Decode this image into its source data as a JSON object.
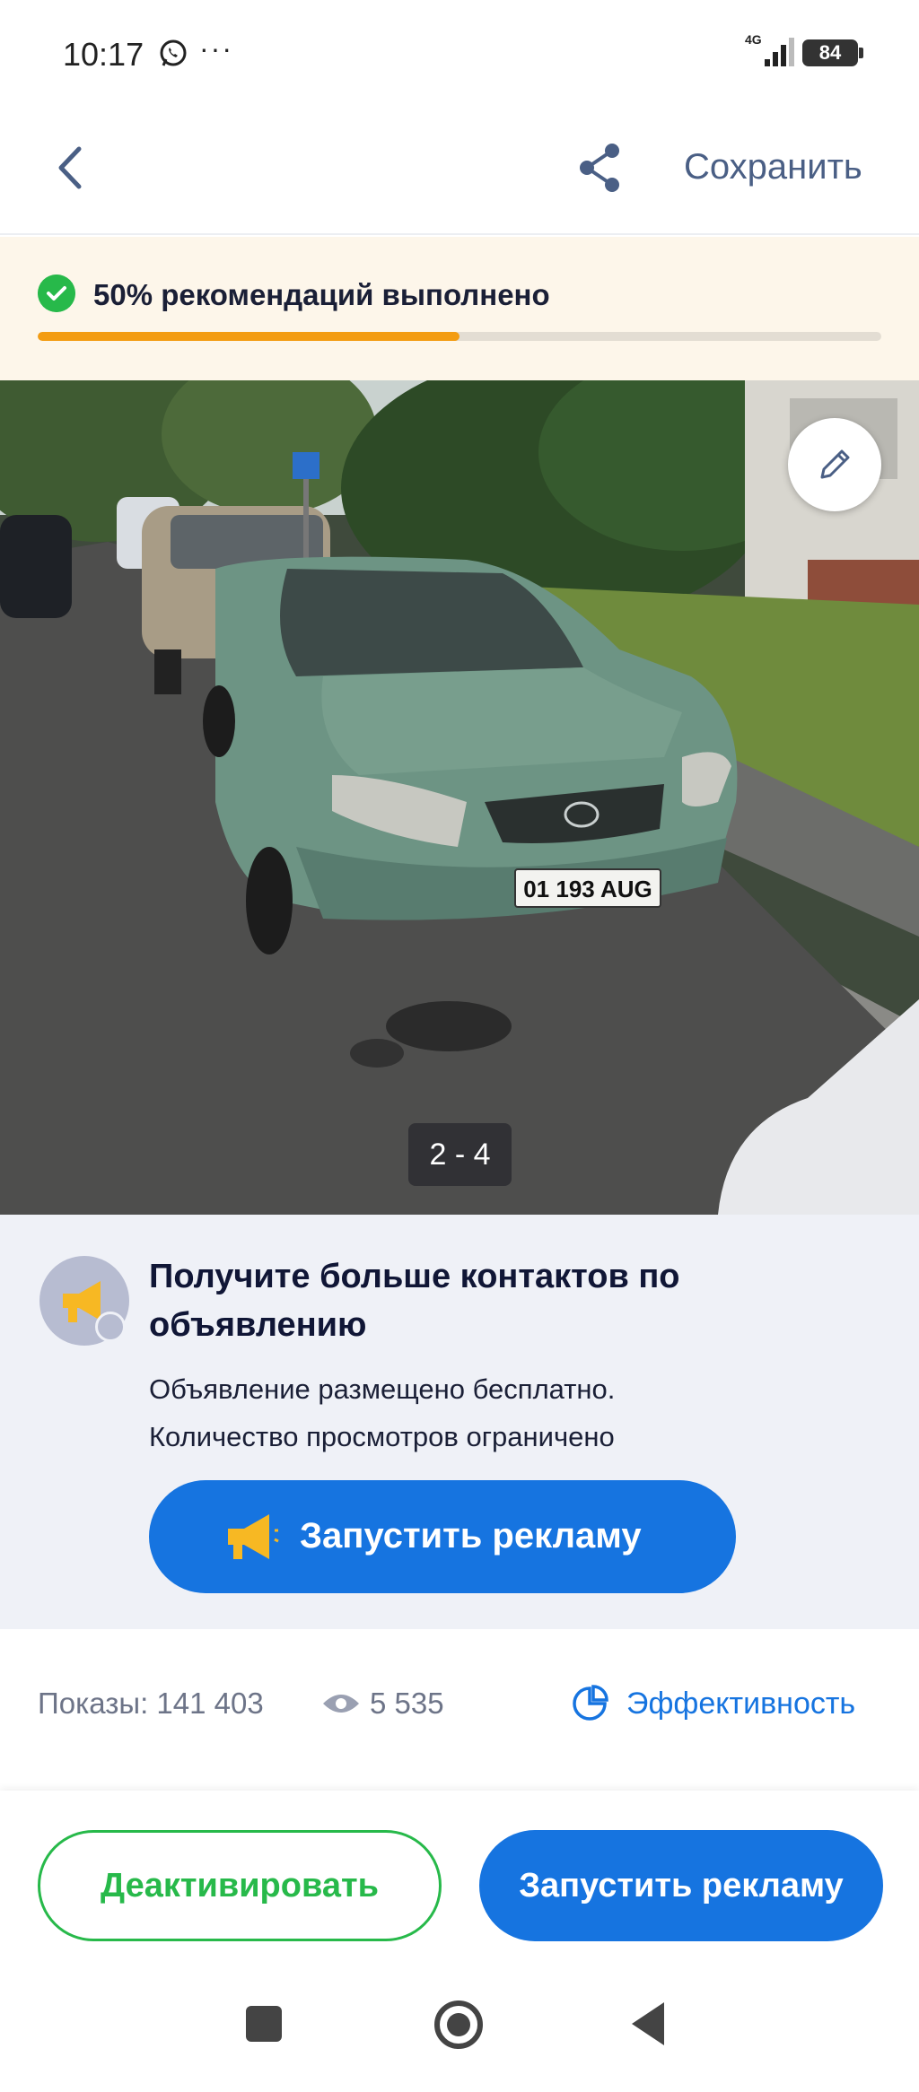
{
  "status_bar": {
    "time": "10:17",
    "dots": "···",
    "network": "4G",
    "battery": "84"
  },
  "header": {
    "save_label": "Сохранить"
  },
  "recommendations": {
    "text": "50% рекомендаций выполнено",
    "progress_percent": 50,
    "progress_color": "#f39c12"
  },
  "photo": {
    "counter": "2 - 4",
    "plate": "01 193 AUG"
  },
  "promo": {
    "title": "Получите больше контактов по объявлению",
    "desc_line1": "Объявление размещено бесплатно.",
    "desc_line2": "Количество просмотров ограничено",
    "button_label": "Запустить рекламу"
  },
  "stats": {
    "shows": "Показы: 141 403",
    "views": "5 535",
    "effectiveness": "Эффективность"
  },
  "actions": {
    "deactivate": "Деактивировать",
    "launch_ads": "Запустить рекламу"
  },
  "colors": {
    "primary": "#1674e0",
    "green": "#27b94a",
    "accent_orange": "#f39c12"
  }
}
